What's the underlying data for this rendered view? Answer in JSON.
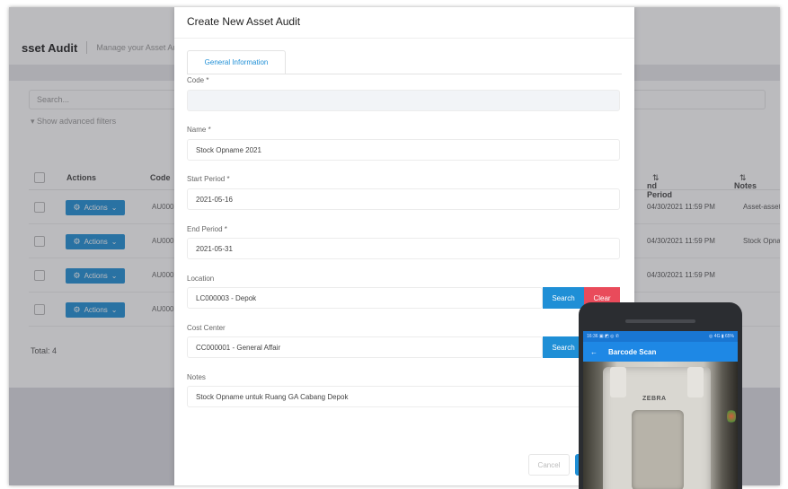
{
  "background": {
    "title": "sset Audit",
    "subtitle": "Manage your Asset Au",
    "search_placeholder": "Search...",
    "advanced_filters": "Show advanced filters",
    "columns": {
      "actions": "Actions",
      "code": "Code",
      "end_period": "nd Period",
      "notes": "Notes",
      "sort_icon": "⇅"
    },
    "rows": [
      {
        "action": "Actions",
        "code": "AU000",
        "end_period": "04/30/2021 11:59 PM",
        "notes": "Asset-asset b"
      },
      {
        "action": "Actions",
        "code": "AU000",
        "end_period": "04/30/2021 11:59 PM",
        "notes": "Stock Opnam"
      },
      {
        "action": "Actions",
        "code": "AU000",
        "end_period": "04/30/2021 11:59 PM",
        "notes": ""
      },
      {
        "action": "Actions",
        "code": "AU000",
        "end_period": "",
        "notes": ""
      }
    ],
    "total": "Total: 4"
  },
  "modal": {
    "title": "Create New Asset Audit",
    "tab": "General Information",
    "fields": {
      "code": {
        "label": "Code *",
        "value": ""
      },
      "name": {
        "label": "Name *",
        "value": "Stock Opname 2021"
      },
      "start": {
        "label": "Start Period *",
        "value": "2021-05-16"
      },
      "end": {
        "label": "End Period *",
        "value": "2021-05-31"
      },
      "location": {
        "label": "Location",
        "value": "LC000003 - Depok"
      },
      "cost_center": {
        "label": "Cost Center",
        "value": "CC000001 - General Affair"
      },
      "notes": {
        "label": "Notes",
        "value": "Stock Opname untuk Ruang GA Cabang Depok"
      }
    },
    "buttons": {
      "search": "Search",
      "clear": "Clear",
      "cancel": "Cancel"
    }
  },
  "phone": {
    "status_left": "16:36 ▣ ◩ ◎ ✆",
    "status_right": "◎ 4G ▮ 65%",
    "app_title": "Barcode Scan",
    "back_icon": "←",
    "device_logo": "ZEBRA"
  },
  "colors": {
    "primary": "#1f8fd6",
    "danger": "#e94b5b"
  }
}
